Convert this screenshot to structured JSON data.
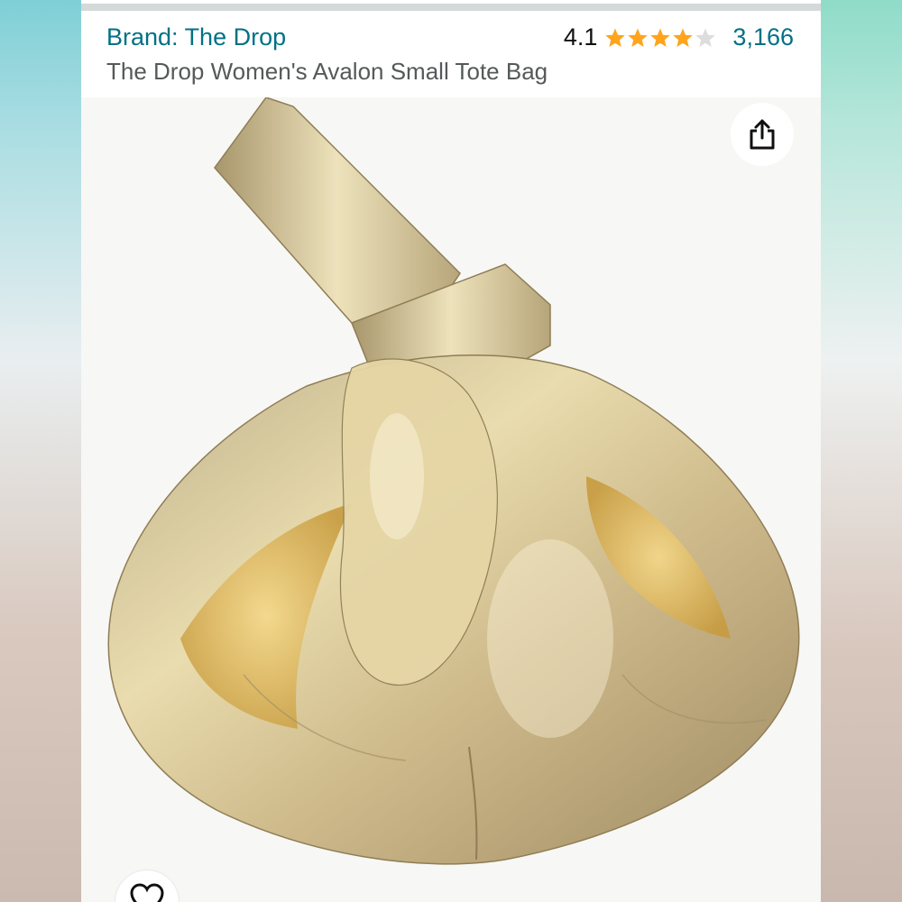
{
  "header": {
    "brand": "Brand: The Drop",
    "title": "The Drop Women's Avalon Small Tote Bag",
    "rating": "4.1",
    "rating_value": 4.1,
    "review_count": "3,166"
  },
  "colors": {
    "link": "#007185",
    "star": "#ffa41c",
    "star_empty": "#dddddd"
  },
  "icons": {
    "share": "share-icon",
    "wishlist": "heart-icon"
  },
  "product_image": {
    "subject": "gold metallic knotted tote bag"
  }
}
